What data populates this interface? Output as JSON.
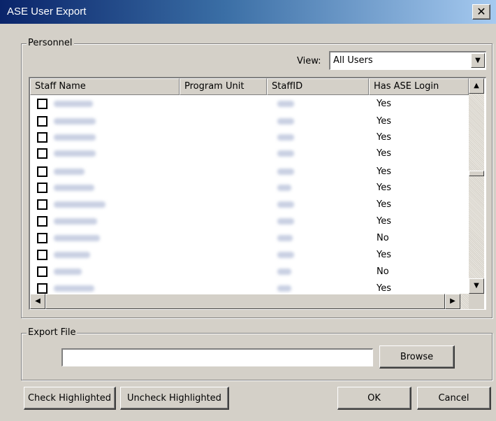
{
  "window": {
    "title": "ASE User Export",
    "close_label": "✕"
  },
  "personnel": {
    "group_label": "Personnel",
    "view_label": "View:",
    "view_value": "All Users",
    "columns": [
      "Staff Name",
      "Program Unit",
      "StaffID",
      "Has ASE Login"
    ],
    "rows": [
      {
        "login": "Yes"
      },
      {
        "login": "Yes"
      },
      {
        "login": "Yes"
      },
      {
        "login": "Yes"
      },
      {
        "login": "Yes"
      },
      {
        "login": "Yes"
      },
      {
        "login": "Yes"
      },
      {
        "login": "Yes"
      },
      {
        "login": "No"
      },
      {
        "login": "Yes"
      },
      {
        "login": "No"
      },
      {
        "login": "Yes"
      }
    ]
  },
  "export": {
    "group_label": "Export File",
    "file_value": "",
    "browse_label": "Browse"
  },
  "buttons": {
    "check_highlighted": "Check Highlighted",
    "uncheck_highlighted": "Uncheck Highlighted",
    "ok": "OK",
    "cancel": "Cancel"
  }
}
